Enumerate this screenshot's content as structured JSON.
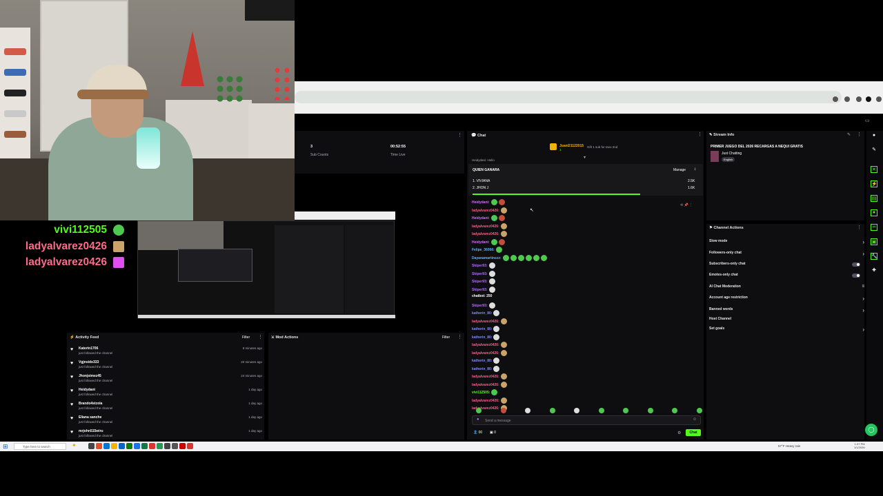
{
  "overlay_chat": [
    {
      "name": "vivi112505",
      "color": "#53fc18",
      "emote_color": "#4ec84f"
    },
    {
      "name": "ladyalvarez0426",
      "color": "#ff6b8a",
      "emote_color": "#c9a36a"
    },
    {
      "name": "ladyalvarez0426",
      "color": "#ff6b8a",
      "emote_color": "#e04ff0"
    }
  ],
  "stats": {
    "subs_value": "3",
    "subs_label": "Sub Counts",
    "time_value": "00:52:55",
    "time_label": "Time Live"
  },
  "chat": {
    "title": "Chat",
    "pinned_user": "Juanl21122015",
    "pinned_sub": "1",
    "gift_text": "Gift 1 sub for tavo 2nd",
    "clipped_line": "Heidydani: Hello",
    "poll_title": "QUIEN GANARA",
    "manage_label": "Manage",
    "poll_options": [
      {
        "label": "1. VIVIANA",
        "value": "2.5K"
      },
      {
        "label": "2. JHON J",
        "value": "1.6K"
      }
    ],
    "messages": [
      {
        "user": "Heidydani:",
        "color": "#d66bff",
        "emotes": 2
      },
      {
        "user": "ladyalvarez0426:",
        "color": "#ff5c8a",
        "emotes": 1
      },
      {
        "user": "Heidydani:",
        "color": "#d66bff",
        "emotes": 2
      },
      {
        "user": "ladyalvarez0426:",
        "color": "#ff5c8a",
        "emotes": 1
      },
      {
        "user": "ladyalvarez0426:",
        "color": "#ff5c8a",
        "emotes": 1
      },
      {
        "user": "Heidydani:",
        "color": "#d66bff",
        "emotes": 2
      },
      {
        "user": "Felipe_36066:",
        "color": "#5cb3ff",
        "emotes": 1
      },
      {
        "user": "Dayanamartinezz:",
        "color": "#5cb3ff",
        "emotes": 6
      },
      {
        "user": "Skiper93:",
        "color": "#b46bff",
        "emotes": 1
      },
      {
        "user": "Skiper93:",
        "color": "#b46bff",
        "emotes": 1
      },
      {
        "user": "Skiper93:",
        "color": "#b46bff",
        "emotes": 1
      },
      {
        "user": "Skiper93:",
        "color": "#b46bff",
        "emotes": 1
      },
      {
        "user": "chatbot: 250",
        "color": "#ffffff",
        "emotes": 0
      },
      {
        "user": "Skiper93:",
        "color": "#b46bff",
        "emotes": 1
      },
      {
        "user": "katherin_80:",
        "color": "#7c8cff",
        "emotes": 1
      },
      {
        "user": "ladyalvarez0426:",
        "color": "#ff5c8a",
        "emotes": 1
      },
      {
        "user": "katherin_80:",
        "color": "#7c8cff",
        "emotes": 1
      },
      {
        "user": "katherin_80:",
        "color": "#7c8cff",
        "emotes": 1
      },
      {
        "user": "ladyalvarez0426:",
        "color": "#ff5c8a",
        "emotes": 1
      },
      {
        "user": "ladyalvarez0426:",
        "color": "#ff5c8a",
        "emotes": 1
      },
      {
        "user": "katherin_80:",
        "color": "#7c8cff",
        "emotes": 1
      },
      {
        "user": "katherin_80:",
        "color": "#7c8cff",
        "emotes": 1
      },
      {
        "user": "ladyalvarez0426:",
        "color": "#ff5c8a",
        "emotes": 1
      },
      {
        "user": "ladyalvarez0426:",
        "color": "#ff5c8a",
        "emotes": 1
      },
      {
        "user": "vivi112505:",
        "color": "#53fc18",
        "emotes": 1
      },
      {
        "user": "ladyalvarez0426:",
        "color": "#ff5c8a",
        "emotes": 1
      },
      {
        "user": "ladyalvarez0426:",
        "color": "#ff5c8a",
        "emotes": 1
      }
    ],
    "input_placeholder": "Send a message",
    "viewer_count": "00",
    "extra_count": "0",
    "send_label": "Chat"
  },
  "stream_info": {
    "header": "Stream Info",
    "title": "PRIMER JUEGO DEL 2026 RECARGAS A NEQUI GRATIS",
    "category": "Just Chatting",
    "tag": "English"
  },
  "channel_actions": {
    "header": "Channel Actions",
    "items": [
      {
        "label": "Slow mode",
        "control": "chevron"
      },
      {
        "label": "Followers-only chat",
        "control": "chevron"
      },
      {
        "label": "Subscribers-only chat",
        "control": "toggle"
      },
      {
        "label": "Emotes-only chat",
        "control": "toggle"
      },
      {
        "label": "AI Chat Moderation",
        "control": "icon"
      },
      {
        "label": "Account age restriction",
        "control": "chevron"
      },
      {
        "label": "Banned words",
        "control": "chevron"
      },
      {
        "label": "Host Channel",
        "control": "none"
      },
      {
        "label": "Set goals",
        "control": "chevron"
      }
    ]
  },
  "activity_feed": {
    "header": "Activity Feed",
    "filter_label": "Filter",
    "items": [
      {
        "name": "Katerin1706",
        "sub": "just followed the channel",
        "time": "8 minutes ago"
      },
      {
        "name": "Vgjnsido333",
        "sub": "just followed the channel",
        "time": "20 minutes ago"
      },
      {
        "name": "Jhonjsimez45",
        "sub": "just followed the channel",
        "time": "24 minutes ago"
      },
      {
        "name": "Heidydani",
        "sub": "just followed the channel",
        "time": "1 day ago"
      },
      {
        "name": "Brando4stzola",
        "sub": "just followed the channel",
        "time": "1 day ago"
      },
      {
        "name": "Eliana sanche",
        "sub": "just followed the channel",
        "time": "1 day ago"
      },
      {
        "name": "mrjohn515wiru",
        "sub": "just followed the channel",
        "time": "1 day ago"
      }
    ]
  },
  "mod_actions": {
    "header": "Mod Actions",
    "filter_label": "Filter"
  },
  "taskbar": {
    "search_placeholder": "Type here to search",
    "weather": "57°F Heavy rain",
    "time": "1:37 PM",
    "date": "1/1/2026"
  }
}
